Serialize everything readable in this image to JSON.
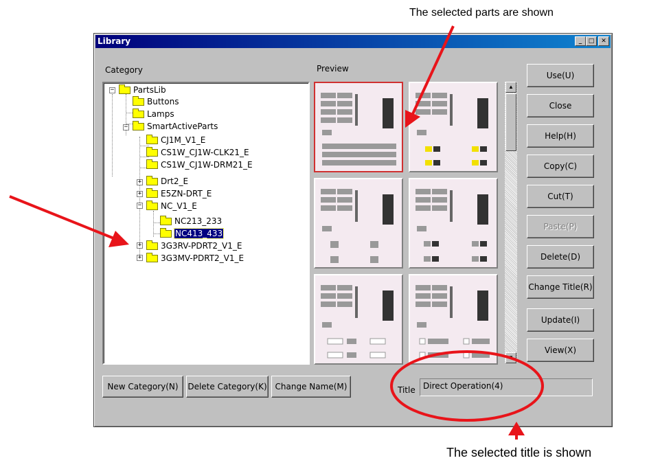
{
  "annotations": {
    "top_caption": "The selected parts are shown",
    "bottom_caption": "The selected title is shown"
  },
  "window": {
    "title": "Library",
    "minimize": "_",
    "maximize": "□",
    "close": "✕"
  },
  "labels": {
    "category": "Category",
    "preview": "Preview",
    "title": "Title"
  },
  "tree": {
    "items": [
      {
        "label": "PartsLib",
        "expander": "−"
      },
      {
        "label": "Buttons"
      },
      {
        "label": "Lamps"
      },
      {
        "label": "SmartActiveParts",
        "expander": "−"
      },
      {
        "label": "CJ1M_V1_E"
      },
      {
        "label": "CS1W_CJ1W-CLK21_E"
      },
      {
        "label": "CS1W_CJ1W-DRM21_E"
      },
      {
        "label": "Drt2_E",
        "expander": "+"
      },
      {
        "label": "E5ZN-DRT_E",
        "expander": "+"
      },
      {
        "label": "NC_V1_E",
        "expander": "−"
      },
      {
        "label": "NC213_233"
      },
      {
        "label": "NC413_433",
        "selected": true
      },
      {
        "label": "3G3RV-PDRT2_V1_E",
        "expander": "+"
      },
      {
        "label": "3G3MV-PDRT2_V1_E",
        "expander": "+"
      }
    ]
  },
  "buttons": {
    "use": "Use(U)",
    "close": "Close",
    "help": "Help(H)",
    "copy": "Copy(C)",
    "cut": "Cut(T)",
    "paste": "Paste(P)",
    "delete": "Delete(D)",
    "change_title": "Change Title(R)",
    "update": "Update(I)",
    "view": "View(X)",
    "new_category": "New Category(N)",
    "delete_category": "Delete Category(K)",
    "change_name": "Change Name(M)"
  },
  "title_field": {
    "value": "Direct Operation(4)"
  },
  "colors": {
    "annotation_red": "#e8141a",
    "titlebar": "#00007b",
    "selection": "#000080",
    "folder": "#ffff00"
  }
}
